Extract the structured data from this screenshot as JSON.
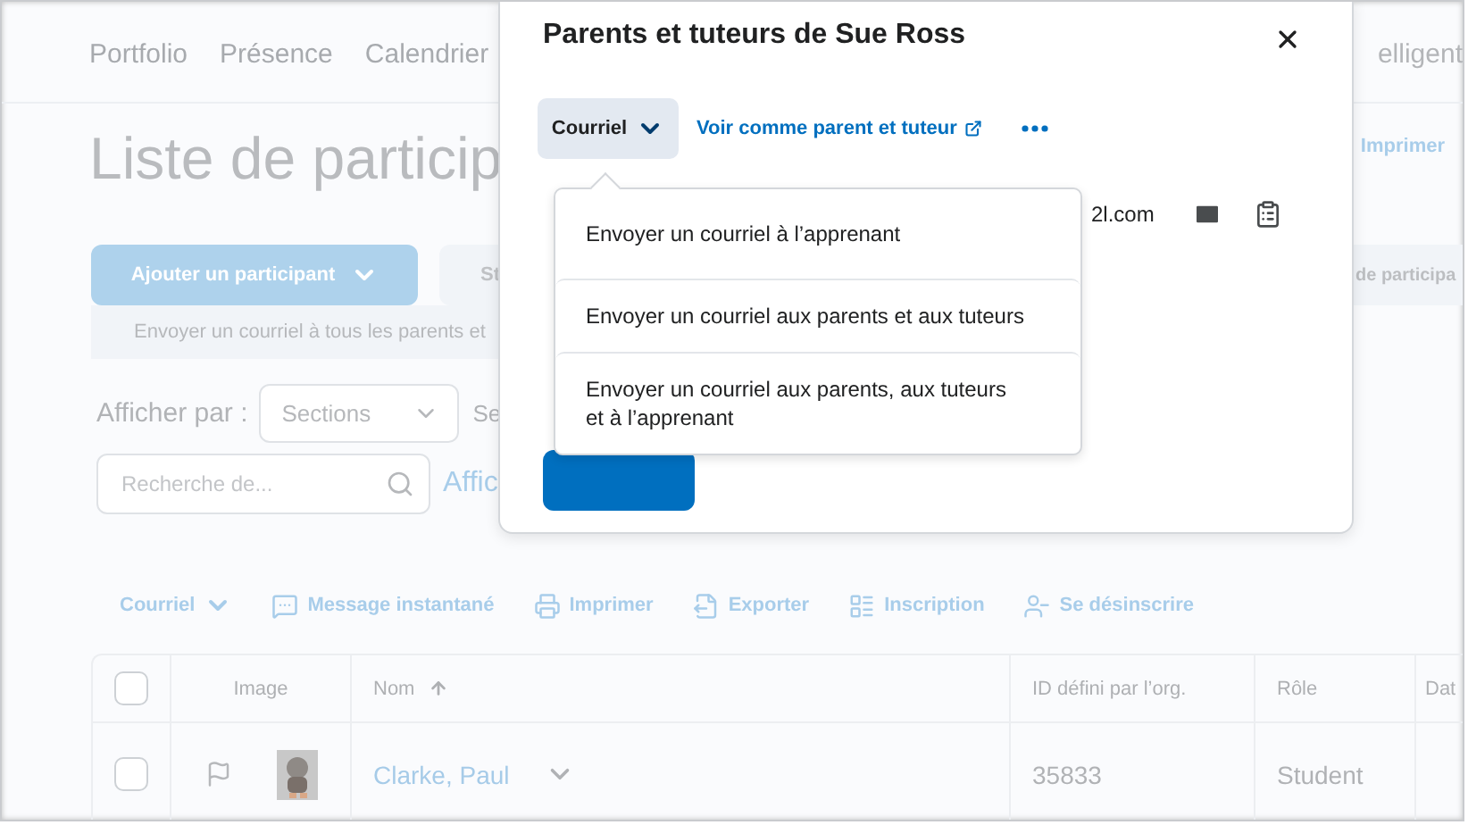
{
  "background": {
    "nav": [
      "Portfolio",
      "Présence",
      "Calendrier"
    ],
    "nav_right": "elligent",
    "title": "Liste de particip",
    "print_link": "Imprimer",
    "add_button": "Ajouter un participant",
    "partial_button": "St",
    "right_panel": "de participa",
    "notice": "Envoyer un courriel à tous les parents et",
    "view_by": {
      "label": "Afficher par :",
      "select": "Sections",
      "next_label": "Se"
    },
    "search": {
      "placeholder": "Recherche de..."
    },
    "search_link": "Affic"
  },
  "toolbar": [
    {
      "kind": "menu",
      "label": "Courriel"
    },
    {
      "kind": "chat",
      "label": "Message instantané"
    },
    {
      "kind": "print",
      "label": "Imprimer"
    },
    {
      "kind": "export",
      "label": "Exporter"
    },
    {
      "kind": "enroll",
      "label": "Inscription"
    },
    {
      "kind": "unenroll",
      "label": "Se désinscrire"
    }
  ],
  "table": {
    "select_all": {
      "checked": false
    },
    "columns": [
      {
        "label": "Image",
        "sorted": false
      },
      {
        "label": "Nom",
        "sorted": true
      },
      {
        "label": "ID défini par l’org.",
        "sorted": false
      },
      {
        "label": "Rôle",
        "sorted": false
      },
      {
        "label": "Dat",
        "sorted": false
      }
    ],
    "rows": [
      {
        "checked": false,
        "name": "Clarke, Paul",
        "id": "35833",
        "role": "Student"
      }
    ]
  },
  "dialog": {
    "title": "Parents et tuteurs de Sue Ross",
    "email_button": "Courriel",
    "view_link": "Voir comme parent et tuteur",
    "email_partial": "2l.com",
    "menu": [
      "Envoyer un courriel à l’apprenant",
      "Envoyer un courriel aux parents et aux tuteurs",
      "Envoyer un courriel aux parents, aux tuteurs et à l’apprenant"
    ]
  }
}
